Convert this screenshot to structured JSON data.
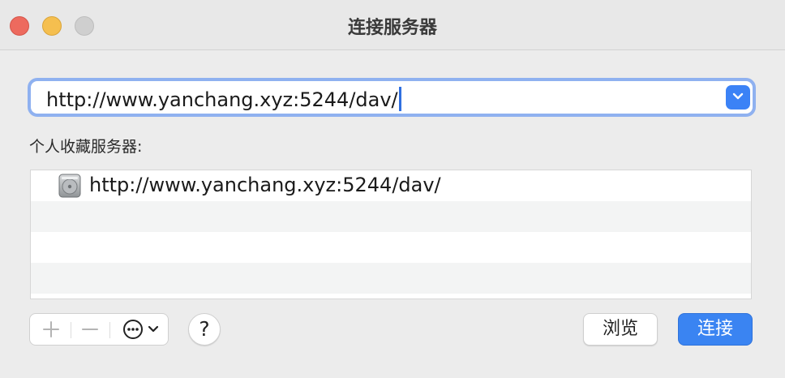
{
  "window": {
    "title": "连接服务器"
  },
  "server_field": {
    "value": "http://www.yanchang.xyz:5244/dav/"
  },
  "favorites": {
    "label": "个人收藏服务器:",
    "items": [
      {
        "label": "http://www.yanchang.xyz:5244/dav/",
        "icon": "network-drive-icon"
      }
    ]
  },
  "toolbar": {
    "add_icon": "plus-icon",
    "remove_icon": "minus-icon",
    "more_icon": "ellipsis-circle-icon",
    "help_label": "?"
  },
  "buttons": {
    "browse_label": "浏览",
    "connect_label": "连接"
  },
  "colors": {
    "accent": "#3a84f2",
    "focus_ring": "#8fb1f0",
    "close": "#ed6a5e",
    "minimize": "#f5bf4f",
    "zoom_disabled": "#cfcfcf"
  }
}
